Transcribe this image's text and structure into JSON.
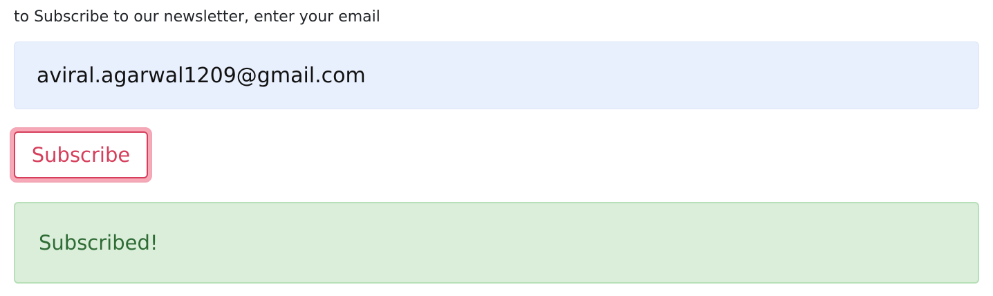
{
  "newsletter": {
    "prompt": "to Subscribe to our newsletter, enter your email",
    "email_value": "aviral.agarwal1209@gmail.com",
    "subscribe_label": "Subscribe",
    "status_message": "Subscribed!"
  },
  "colors": {
    "input_background": "#e8effd",
    "button_accent": "#d63e5b",
    "button_focus_ring": "#f7a9b8",
    "success_background": "#daeeda",
    "success_border": "#b8dfb8",
    "success_text": "#2f6b35"
  }
}
